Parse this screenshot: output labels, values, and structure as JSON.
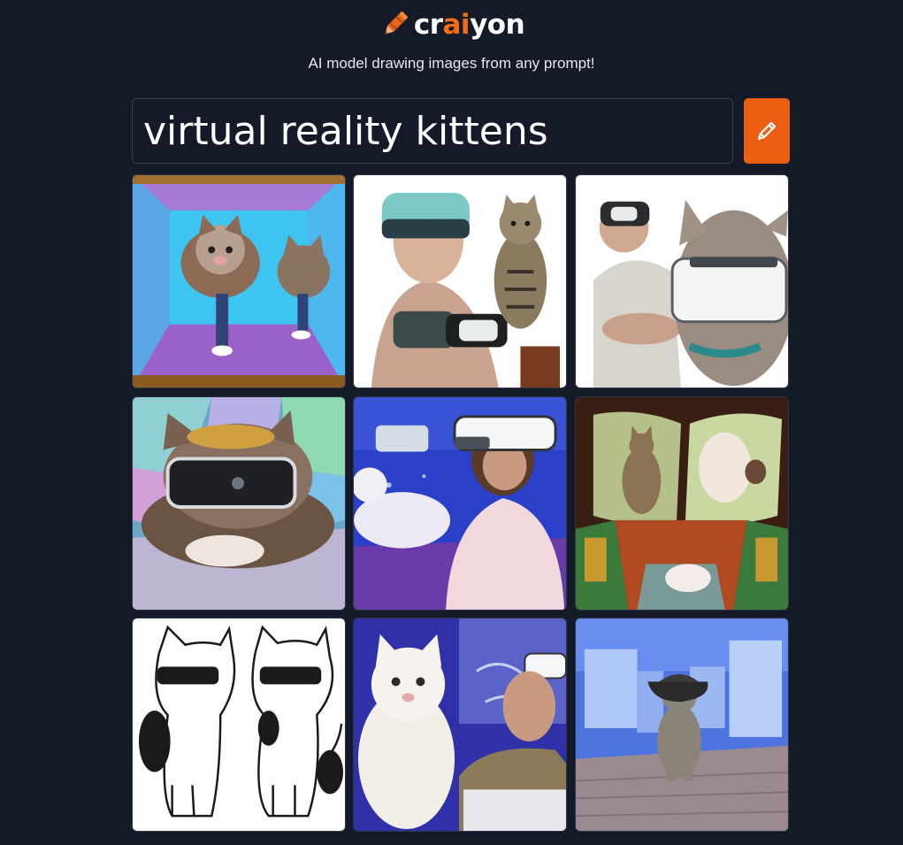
{
  "app": {
    "logo_prefix": "cr",
    "logo_accent": "ai",
    "logo_suffix": "yon",
    "tagline": "AI model drawing images from any prompt!",
    "brand_color": "#f06d16"
  },
  "search": {
    "value": "virtual reality kittens",
    "button_icon": "pencil-icon"
  },
  "results": [
    {
      "id": 1
    },
    {
      "id": 2
    },
    {
      "id": 3
    },
    {
      "id": 4
    },
    {
      "id": 5
    },
    {
      "id": 6
    },
    {
      "id": 7
    },
    {
      "id": 8
    },
    {
      "id": 9
    }
  ]
}
